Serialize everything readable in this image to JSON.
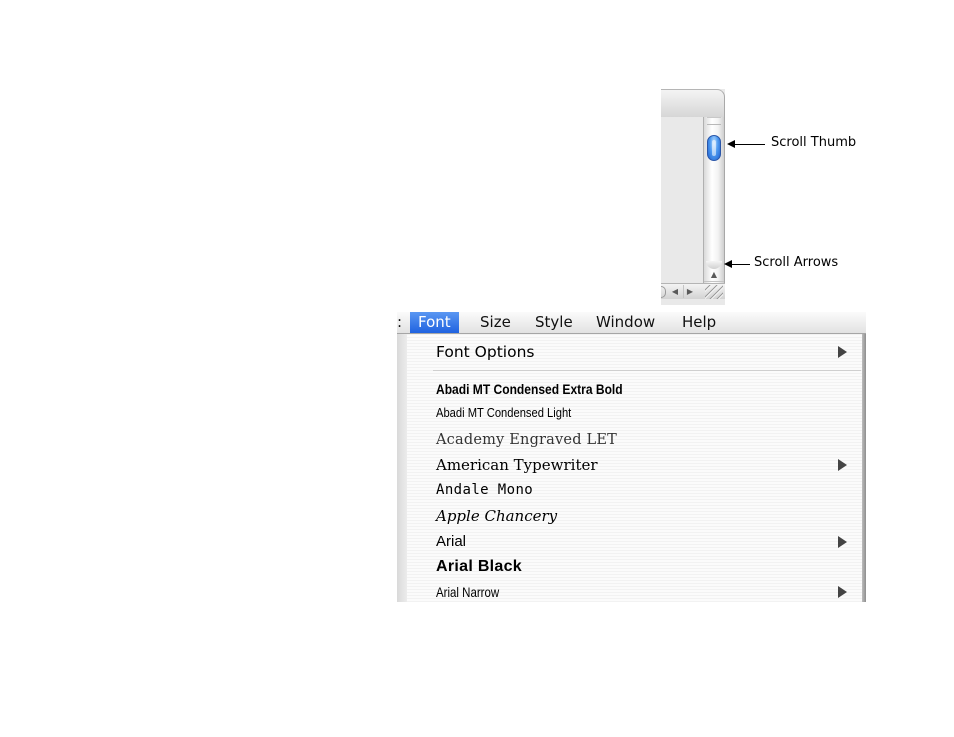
{
  "callouts": {
    "scroll_thumb": "Scroll Thumb",
    "scroll_arrows": "Scroll Arrows"
  },
  "scrollbar": {
    "up_arrow_glyph": "▲",
    "down_arrow_glyph": "▼",
    "left_arrow_glyph": "◀",
    "right_arrow_glyph": "▶",
    "thumb_color": "#3d86ea"
  },
  "menubar": {
    "partial_title": ":",
    "titles": [
      "Font",
      "Size",
      "Style",
      "Window",
      "Help"
    ],
    "active_index": 0,
    "highlight_color": "#2f73e6"
  },
  "font_menu": {
    "items": [
      {
        "label": "Font Options",
        "has_submenu": true
      },
      {
        "label": "Abadi MT Condensed Extra Bold",
        "has_submenu": false
      },
      {
        "label": "Abadi MT Condensed Light",
        "has_submenu": false
      },
      {
        "label": "Academy Engraved LET",
        "has_submenu": false
      },
      {
        "label": "American Typewriter",
        "has_submenu": true
      },
      {
        "label": "Andale Mono",
        "has_submenu": false
      },
      {
        "label": "Apple Chancery",
        "has_submenu": false
      },
      {
        "label": "Arial",
        "has_submenu": true
      },
      {
        "label": "Arial Black",
        "has_submenu": false
      },
      {
        "label": "Arial Narrow",
        "has_submenu": true
      }
    ]
  }
}
